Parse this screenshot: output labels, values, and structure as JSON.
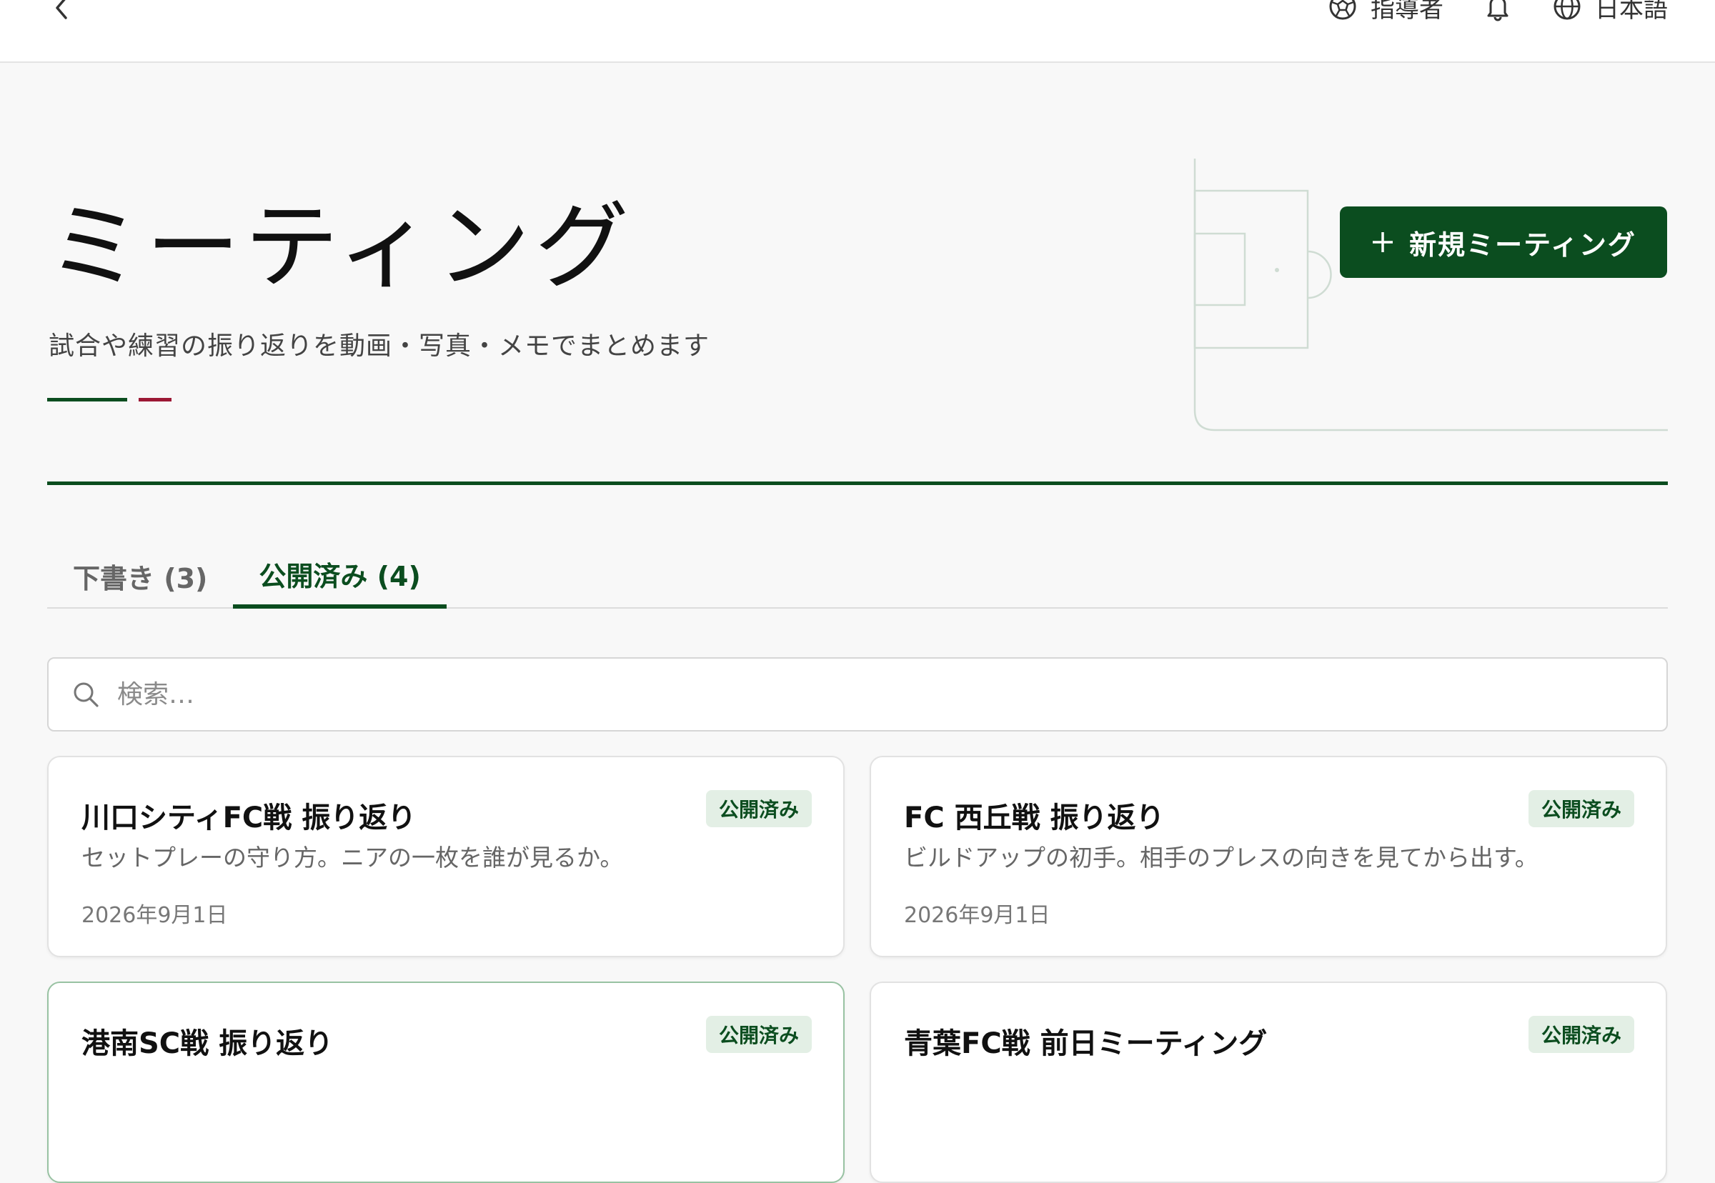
{
  "topbar": {
    "role_label": "指導者",
    "language_label": "日本語"
  },
  "hero": {
    "title": "ミーティング",
    "subtitle": "試合や練習の振り返りを動画・写真・メモでまとめます",
    "new_button_label": "新規ミーティング"
  },
  "tabs": [
    {
      "label": "下書き (3)",
      "active": false
    },
    {
      "label": "公開済み (4)",
      "active": true
    }
  ],
  "search": {
    "placeholder": "検索…",
    "value": ""
  },
  "cards": [
    {
      "title": "川口シティFC戦 振り返り",
      "description": "セットプレーの守り方。ニアの一枚を誰が見るか。",
      "date": "2026年9月1日",
      "status": "公開済み"
    },
    {
      "title": "FC 西丘戦 振り返り",
      "description": "ビルドアップの初手。相手のプレスの向きを見てから出す。",
      "date": "2026年9月1日",
      "status": "公開済み"
    },
    {
      "title": "港南SC戦 振り返り",
      "description": "",
      "date": "",
      "status": "公開済み"
    },
    {
      "title": "青葉FC戦 前日ミーティング",
      "description": "",
      "date": "",
      "status": "公開済み"
    }
  ],
  "colors": {
    "brand_green": "#0b4d1f",
    "accent_red": "#9c1834",
    "badge_bg": "#e3efe5"
  },
  "icons": {
    "back": "chevron-left-icon",
    "role": "soccer-ball-icon",
    "notifications": "bell-icon",
    "language": "globe-icon",
    "add": "plus-icon",
    "search": "search-icon"
  }
}
